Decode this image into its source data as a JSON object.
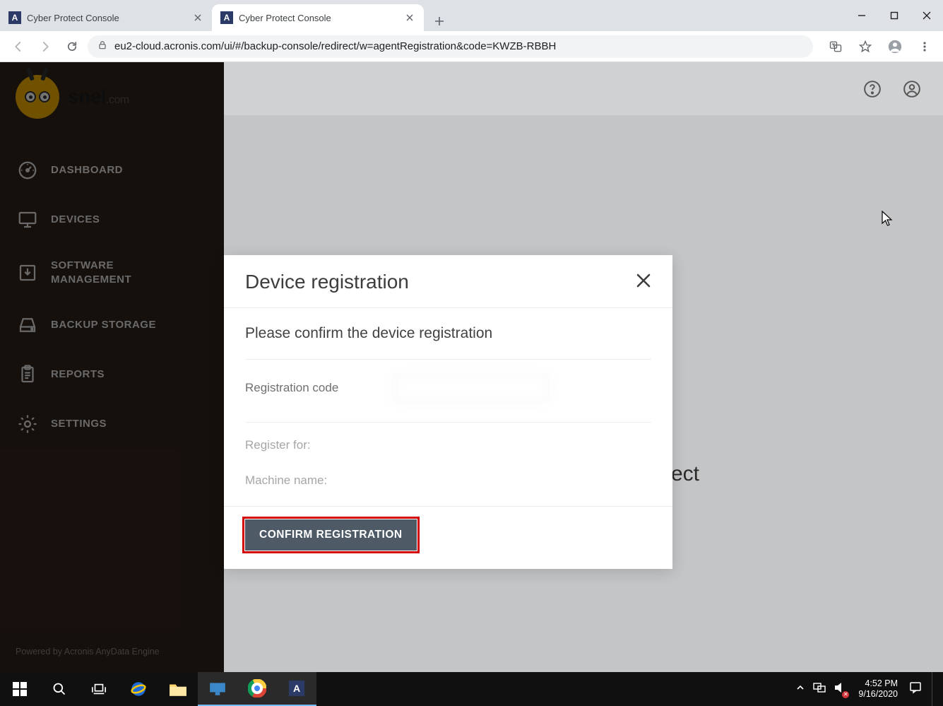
{
  "browser": {
    "tabs": [
      {
        "title": "Cyber Protect Console",
        "favicon": "A"
      },
      {
        "title": "Cyber Protect Console",
        "favicon": "A"
      }
    ],
    "url": "eu2-cloud.acronis.com/ui/#/backup-console/redirect/w=agentRegistration&code=KWZB-RBBH"
  },
  "brand": {
    "name": "snel",
    "suffix": ".com"
  },
  "sidebar": {
    "items": [
      {
        "label": "DASHBOARD",
        "icon": "gauge-icon"
      },
      {
        "label": "DEVICES",
        "icon": "monitor-icon"
      },
      {
        "label": "SOFTWARE\nMANAGEMENT",
        "icon": "download-box-icon"
      },
      {
        "label": "BACKUP STORAGE",
        "icon": "disk-icon"
      },
      {
        "label": "REPORTS",
        "icon": "clipboard-icon"
      },
      {
        "label": "SETTINGS",
        "icon": "gear-icon"
      }
    ],
    "footer": "Powered by Acronis AnyData Engine"
  },
  "background": {
    "partial_text": "ect"
  },
  "modal": {
    "title": "Device registration",
    "subtitle": "Please confirm the device registration",
    "fields": {
      "registration_code": {
        "label": "Registration code",
        "value": ""
      },
      "register_for": {
        "label": "Register for:",
        "value": ""
      },
      "machine_name": {
        "label": "Machine name:",
        "value": ""
      }
    },
    "confirm_button": "CONFIRM REGISTRATION"
  },
  "taskbar": {
    "time": "4:52 PM",
    "date": "9/16/2020"
  }
}
